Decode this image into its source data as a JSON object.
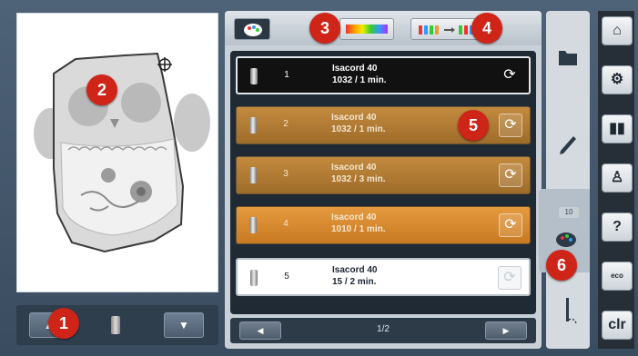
{
  "toolbar": {
    "left_button_icon": "palette-icon",
    "rainbow_button_icon": "color-rainbow-icon",
    "sequence_button_icon": "color-sequence-icon"
  },
  "colors": {
    "row_brown": "#b07a34",
    "row_orange": "#e0902f",
    "callout_red": "#cf2418"
  },
  "threads": [
    {
      "num": "1",
      "name": "Isacord 40",
      "info": "1032 / 1 min."
    },
    {
      "num": "2",
      "name": "Isacord 40",
      "info": "1032 / 1 min."
    },
    {
      "num": "3",
      "name": "Isacord 40",
      "info": "1032 / 3 min."
    },
    {
      "num": "4",
      "name": "Isacord 40",
      "info": "1010 / 1 min."
    },
    {
      "num": "5",
      "name": "Isacord 40",
      "info": "15 / 2 min."
    }
  ],
  "pager": {
    "label": "1/2",
    "prev_icon": "arrow-left-icon",
    "next_icon": "arrow-right-icon"
  },
  "tools": {
    "badge": "10",
    "icons": [
      "folder-icon",
      "pencil-icon",
      "color-palette-icon",
      "needle-icon"
    ]
  },
  "system": {
    "help_label": "?",
    "clr_label": "clr",
    "eco_label": "eco"
  },
  "callouts": [
    "1",
    "2",
    "3",
    "4",
    "5",
    "6"
  ]
}
